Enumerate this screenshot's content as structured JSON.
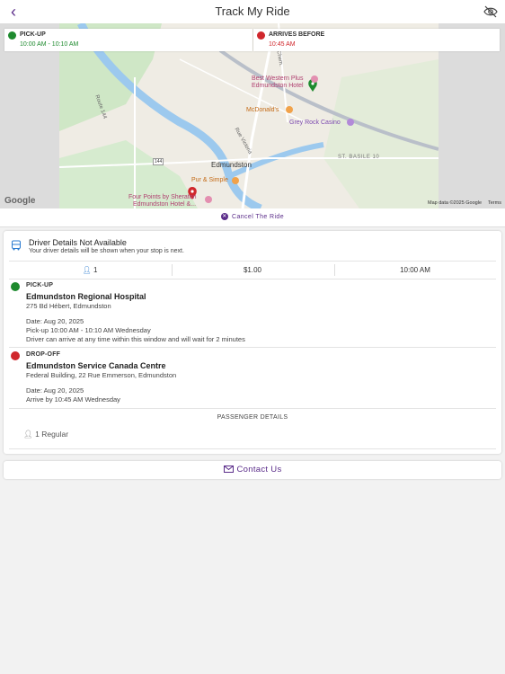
{
  "header": {
    "title": "Track My Ride"
  },
  "info": {
    "pickup_label": "PICK-UP",
    "pickup_time": "10:00 AM - 10:10 AM",
    "arrive_label": "ARRIVES BEFORE",
    "arrive_time": "10:45 AM"
  },
  "map": {
    "labels": {
      "best_western": "Best Western Plus",
      "best_western2": "Edmundston Hotel",
      "mcdonalds": "McDonald's",
      "casino": "Grey Rock Casino",
      "edmundston": "Edmundston",
      "st_basile": "ST. BASILE 10",
      "pur_simple": "Pur & Simple",
      "four_points": "Four Points by Sheraton",
      "four_points2": "Edmundston Hotel &...",
      "route_144": "144",
      "rue_victoria": "Rue Victoria",
      "ave_victoria": "Route 144",
      "google": "Google",
      "map_data": "Map data ©2025 Google",
      "terms": "Terms",
      "north_road": "Chem."
    }
  },
  "cancel": {
    "label": "Cancel The Ride"
  },
  "driver": {
    "title": "Driver Details Not Available",
    "subtitle": "Your driver details will be shown when your stop is next."
  },
  "stats": {
    "passengers": "1",
    "fare": "$1.00",
    "time": "10:00 AM"
  },
  "pickup": {
    "label": "PICK-UP",
    "name": "Edmundston Regional Hospital",
    "address": "275 Bd Hébert, Edmundston",
    "date": "Date: Aug 20, 2025",
    "window": "Pick-up 10:00 AM - 10:10 AM Wednesday",
    "note": "Driver can arrive at any time within this window and will wait for 2 minutes"
  },
  "dropoff": {
    "label": "DROP-OFF",
    "name": "Edmundston Service Canada Centre",
    "address": "Federal Building, 22 Rue Emmerson, Edmundston",
    "date": "Date: Aug 20, 2025",
    "arrive": "Arrive by 10:45 AM Wednesday"
  },
  "passengers": {
    "title": "PASSENGER DETAILS",
    "row": "1 Regular"
  },
  "contact": {
    "label": "Contact Us"
  },
  "colors": {
    "accent": "#5b2d8a",
    "green": "#1e8a2e",
    "red": "#d0272c"
  }
}
